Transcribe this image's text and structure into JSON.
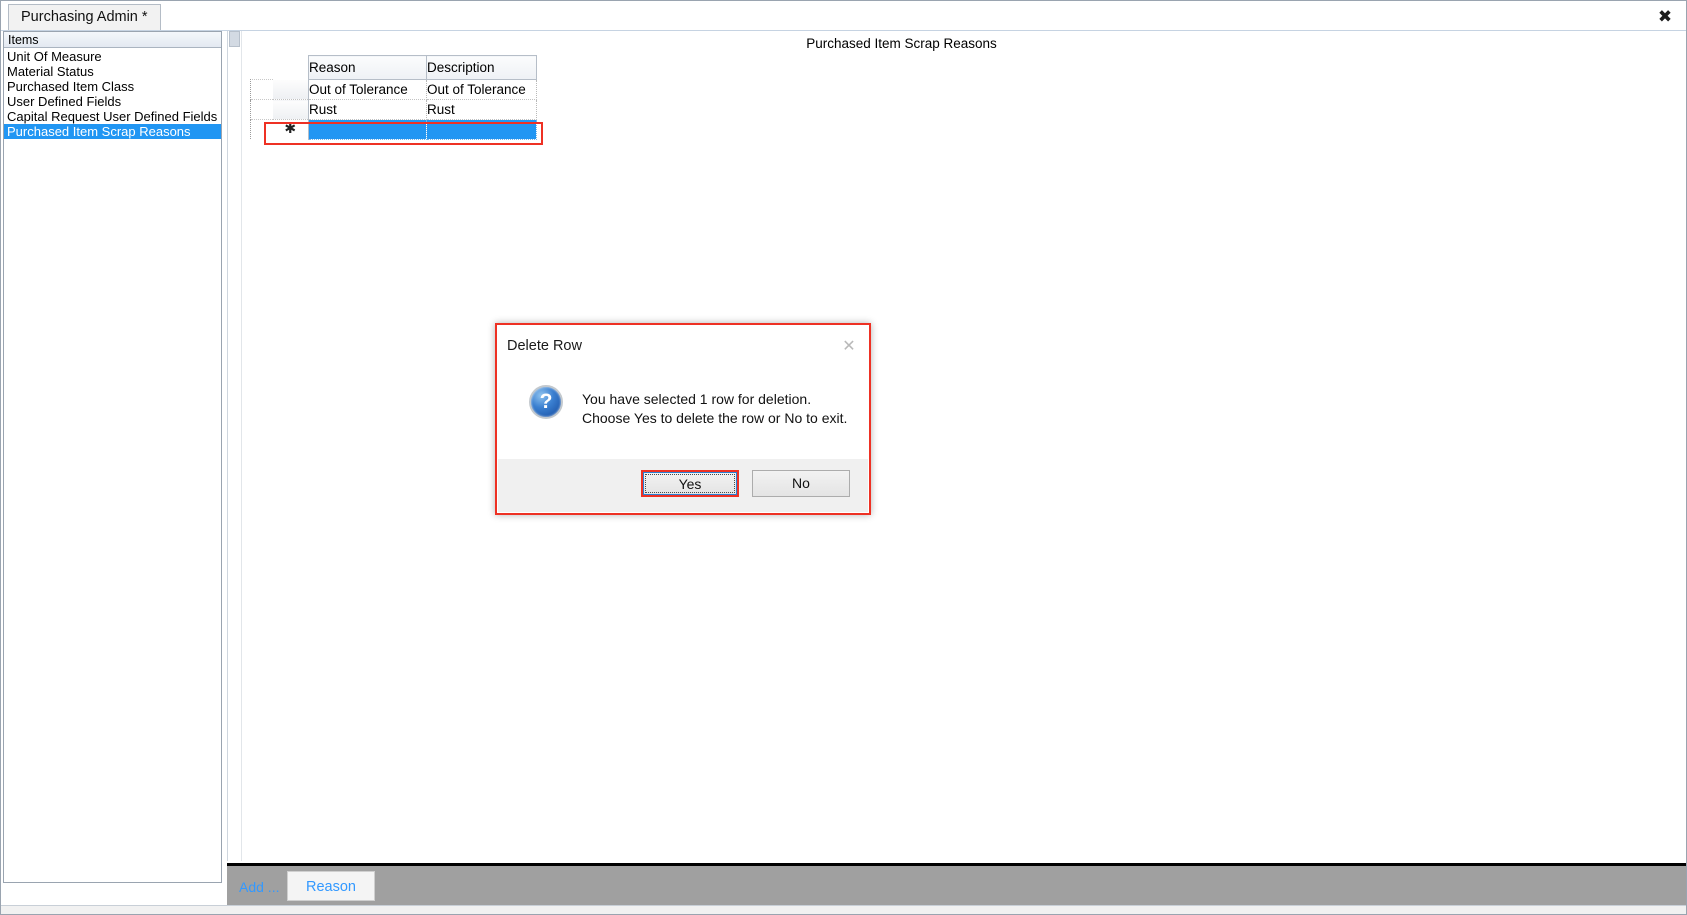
{
  "window": {
    "tab_label": "Purchasing Admin *",
    "close_icon": "close-icon",
    "close_glyph": "✖"
  },
  "sidebar": {
    "header": "Items",
    "items": [
      {
        "label": "Unit Of Measure",
        "selected": false
      },
      {
        "label": "Material Status",
        "selected": false
      },
      {
        "label": "Purchased Item Class",
        "selected": false
      },
      {
        "label": "User Defined Fields",
        "selected": false
      },
      {
        "label": "Capital Request User Defined Fields",
        "selected": false
      },
      {
        "label": "Purchased Item Scrap Reasons",
        "selected": true
      }
    ],
    "selected_color": "#2196f3"
  },
  "content": {
    "title": "Purchased Item Scrap Reasons",
    "grid": {
      "columns": [
        "Reason",
        "Description"
      ],
      "rows": [
        {
          "reason": "Out of Tolerance",
          "description": "Out of Tolerance",
          "state": "normal"
        },
        {
          "reason": "Rust",
          "description": "Rust",
          "state": "normal"
        },
        {
          "reason": "",
          "description": "",
          "state": "new-selected"
        }
      ],
      "new_row_marker": "✱",
      "highlight_color": "#ee3124"
    }
  },
  "toolbar": {
    "add_label": "Add ...",
    "reason_button": "Reason",
    "link_color": "#3399ff",
    "background": "#a0a0a0"
  },
  "dialog": {
    "title": "Delete Row",
    "close_icon": "close-icon",
    "close_glyph": "✕",
    "icon": "question-icon",
    "icon_glyph": "?",
    "message_line1": "You have selected 1 row for deletion.",
    "message_line2": "Choose Yes to delete the row or No to exit.",
    "buttons": {
      "yes": "Yes",
      "no": "No"
    },
    "border_color": "#ee3124",
    "focus_color": "#2a7fd4"
  }
}
